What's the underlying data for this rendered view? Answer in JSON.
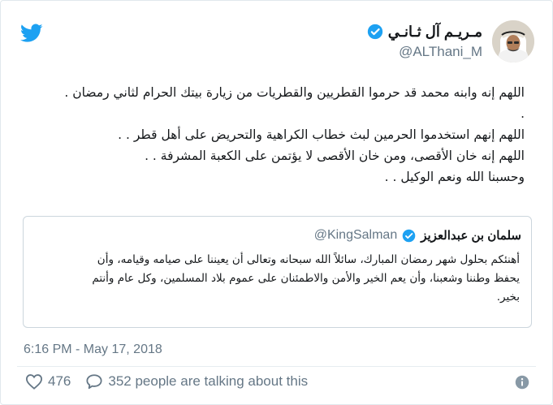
{
  "author": {
    "display_name": "مـريـم آل ثـانـي",
    "handle": "@ALThani_M"
  },
  "tweet": {
    "lines": [
      "اللهم إنه وابنه محمد قد حرموا القطريين والقطريات من زيارة بيتك الحرام لثاني رمضان .",
      ".",
      "اللهم إنهم استخدموا الحرمين لبث خطاب الكراهية والتحريض على أهل قطر . .",
      "اللهم إنه خان الأقصى، ومن خان الأقصى لا يؤتمن على الكعبة المشرفة . .",
      "وحسبنا الله ونعم الوكيل . ."
    ]
  },
  "quoted": {
    "display_name": "سلمان بن عبدالعزيز",
    "handle": "@KingSalman",
    "lines": [
      "أهنئكم بحلول شهر رمضان المبارك، سائلاً الله سبحانه وتعالى أن يعيننا على صيامه وقيامه، وأن",
      "يحفظ وطننا وشعبنا، وأن يعم الخير والأمن والاطمئنان على عموم بلاد المسلمين، وكل عام وأنتم",
      "بخير."
    ]
  },
  "meta": {
    "timestamp": "6:16 PM - May 17, 2018"
  },
  "actions": {
    "likes": "476",
    "replies": "352 people are talking about this"
  },
  "colors": {
    "twitter_blue": "#1da1f2",
    "muted_text": "#657786",
    "border": "#e1e8ed"
  },
  "icons": {
    "brand": "twitter-bird-icon",
    "verified": "verified-badge-icon",
    "like": "heart-icon",
    "reply": "speech-bubble-icon",
    "info": "info-icon"
  }
}
